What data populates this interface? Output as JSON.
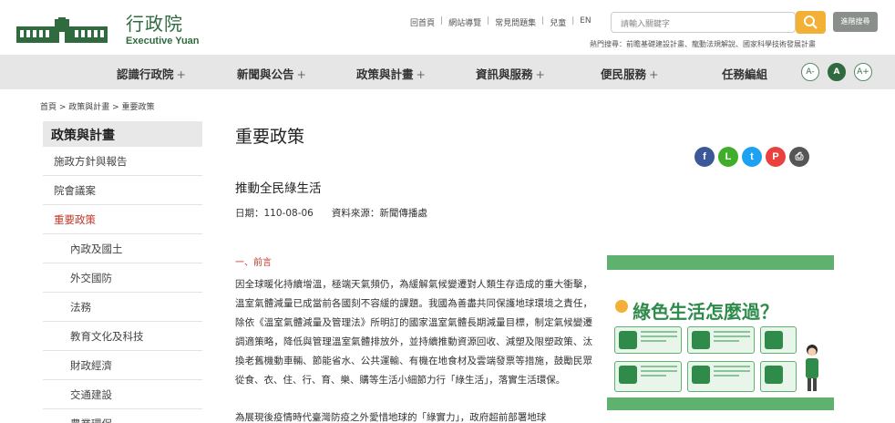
{
  "header": {
    "logo_cn": "行政院",
    "logo_en": "Executive Yuan",
    "top_links": [
      "回首頁",
      "網站導覽",
      "常見問題集",
      "兒童",
      "EN"
    ],
    "search_placeholder": "請輸入關鍵字",
    "advanced_search": "進階搜尋",
    "hot_search": "熱門搜尋：前瞻基礎建設計畫、龍動法規解說、國家科學技術發展計畫"
  },
  "nav": {
    "items": [
      "認識行政院",
      "新聞與公告",
      "政策與計畫",
      "資訊與服務",
      "便民服務",
      "任務編組"
    ],
    "has_plus": [
      true,
      true,
      true,
      true,
      true,
      false
    ],
    "font_sizes": [
      "A-",
      "A",
      "A+"
    ]
  },
  "breadcrumb": "首頁 > 政策與計畫 > 重要政策",
  "sidebar": {
    "title": "政策與計畫",
    "items": [
      {
        "label": "施政方針與報告",
        "active": false,
        "sub": false
      },
      {
        "label": "院會議案",
        "active": false,
        "sub": false
      },
      {
        "label": "重要政策",
        "active": true,
        "sub": false
      },
      {
        "label": "內政及國土",
        "active": false,
        "sub": true
      },
      {
        "label": "外交國防",
        "active": false,
        "sub": true
      },
      {
        "label": "法務",
        "active": false,
        "sub": true
      },
      {
        "label": "教育文化及科技",
        "active": false,
        "sub": true
      },
      {
        "label": "財政經濟",
        "active": false,
        "sub": true
      },
      {
        "label": "交通建設",
        "active": false,
        "sub": true
      },
      {
        "label": "農業環保",
        "active": false,
        "sub": true
      }
    ]
  },
  "main": {
    "page_title": "重要政策",
    "article_title": "推動全民綠生活",
    "date": "日期：110-08-06",
    "source": "資料來源：新聞傳播處",
    "section_heading": "一、前言",
    "paragraph1": "因全球暖化持續增溫，極端天氣頻仍，為緩解氣候變遷對人類生存造成的重大衝擊，溫室氣體減量已成當前各國刻不容緩的課題。我國為善盡共同保護地球環境之責任，除依《溫室氣體減量及管理法》所明訂的國家溫室氣體長期減量目標，制定氣候變遷調適策略，降低與管理溫室氣體排放外，並持續推動資源回收、減塑及限塑政策、汰換老舊機動車輛、節能省水、公共運輸、有機在地食材及雲端發票等措施，鼓勵民眾從食、衣、住、行、育、樂、購等生活小細節力行「綠生活」，落實生活環保。",
    "paragraph2": "為展現後疫情時代臺灣防疫之外愛惜地球的「綠實力」，政府超前部署地球"
  },
  "banner": {
    "title": "綠色生活怎麼過？"
  },
  "share_icons": [
    {
      "name": "facebook-icon",
      "glyph": "f",
      "color": "#3b5998"
    },
    {
      "name": "line-icon",
      "glyph": "L",
      "color": "#3fae2a"
    },
    {
      "name": "twitter-icon",
      "glyph": "t",
      "color": "#1da1f2"
    },
    {
      "name": "plurk-icon",
      "glyph": "P",
      "color": "#e8413e"
    },
    {
      "name": "print-icon",
      "glyph": "⎙",
      "color": "#555555"
    }
  ],
  "colors": {
    "brand_green": "#2f6b3f",
    "active_red": "#c0392b",
    "search_yellow": "#f2b134"
  }
}
